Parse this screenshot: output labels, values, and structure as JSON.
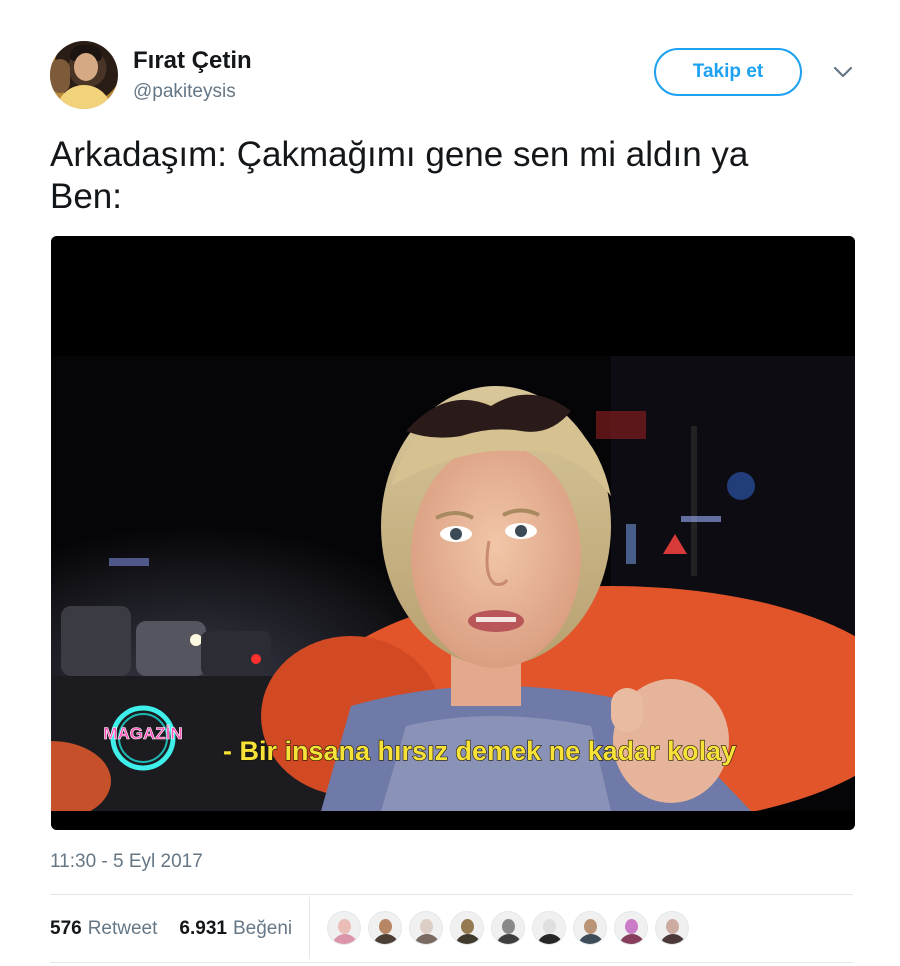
{
  "user": {
    "name": "Fırat Çetin",
    "handle": "@pakiteysis",
    "follow_label": "Takip et",
    "avatar_icon": "profile-photo-avatar",
    "more_icon": "chevron-down-icon"
  },
  "tweet": {
    "text": "Arkadaşım: Çakmağımı gene sen mi aldın ya\nBen:",
    "media": {
      "logo_text": "MAGAZİN",
      "subtitle": "- Bir insana hırsız demek ne kadar kolay"
    },
    "timestamp": "11:30 - 5 Eyl 2017"
  },
  "stats": {
    "retweet_count": "576",
    "retweet_label": "Retweet",
    "like_count": "6.931",
    "like_label": "Beğeni"
  },
  "likers": [
    {
      "face": "#e9b7b0",
      "body": "#d88aa0"
    },
    {
      "face": "#b07a55",
      "body": "#3a2a20"
    },
    {
      "face": "#d9c9c0",
      "body": "#6d5a50"
    },
    {
      "face": "#8a6b3f",
      "body": "#2e2418"
    },
    {
      "face": "#7d7d7d",
      "body": "#2b2b2b"
    },
    {
      "face": "#dddddd",
      "body": "#111111"
    },
    {
      "face": "#b58a6a",
      "body": "#2a3b48"
    },
    {
      "face": "#c66fc2",
      "body": "#7a2a4a"
    },
    {
      "face": "#c9a39a",
      "body": "#3a2626"
    }
  ],
  "colors": {
    "accent": "#1da1f2",
    "muted": "#657786",
    "text": "#14171a",
    "subtitle_yellow": "#f7e23a",
    "logo_magenta": "#ff4fb8",
    "logo_cyan": "#3ff0ea"
  }
}
